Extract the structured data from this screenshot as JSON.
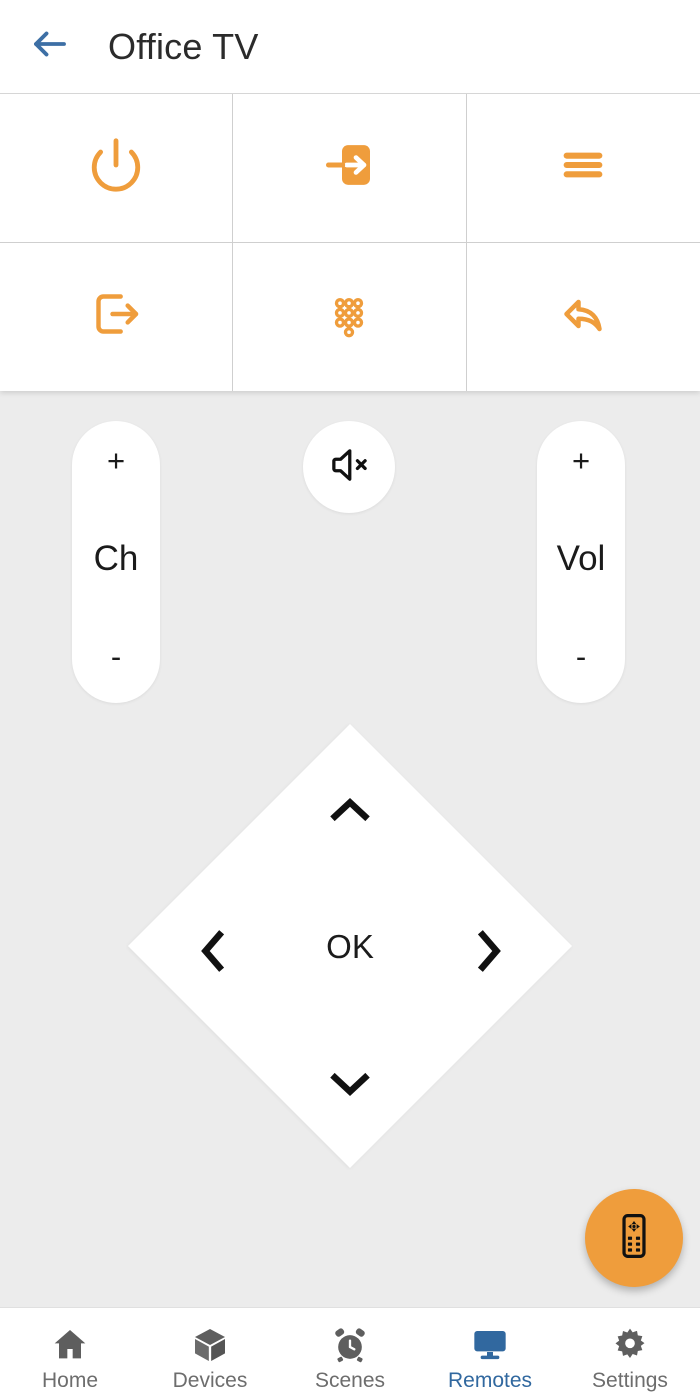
{
  "header": {
    "back_icon": "arrow-left-icon",
    "title": "Office TV",
    "back_color": "#3d6fa5"
  },
  "theme": {
    "accent_orange": "#ef9d3c",
    "active_blue": "#31689f",
    "pad_background": "#ececec",
    "surface": "#ffffff",
    "divider": "#cfcfcf",
    "text_dark": "#1b1b1b",
    "text_muted": "#6d6d6d"
  },
  "button_grid": [
    {
      "name": "power-button",
      "icon": "power-icon",
      "label": "Power"
    },
    {
      "name": "input-button",
      "icon": "input-icon",
      "label": "Input"
    },
    {
      "name": "menu-button",
      "icon": "menu-icon",
      "label": "Menu"
    },
    {
      "name": "exit-button",
      "icon": "exit-icon",
      "label": "Exit"
    },
    {
      "name": "keypad-button",
      "icon": "keypad-icon",
      "label": "Keypad"
    },
    {
      "name": "back-button",
      "icon": "reply-back-icon",
      "label": "Back"
    }
  ],
  "controls": {
    "channel": {
      "plus": "+",
      "label": "Ch",
      "minus": "-"
    },
    "volume": {
      "plus": "+",
      "label": "Vol",
      "minus": "-"
    },
    "mute": {
      "icon": "volume-mute-icon",
      "label": "Mute"
    },
    "dpad": {
      "up_icon": "chevron-up-icon",
      "down_icon": "chevron-down-icon",
      "left_icon": "chevron-left-icon",
      "right_icon": "chevron-right-icon",
      "ok_label": "OK"
    },
    "fab": {
      "icon": "remote-control-icon",
      "label": "Remote"
    }
  },
  "bottom_nav": {
    "active_index": 3,
    "items": [
      {
        "label": "Home",
        "icon": "home-icon"
      },
      {
        "label": "Devices",
        "icon": "cube-icon"
      },
      {
        "label": "Scenes",
        "icon": "alarm-clock-icon"
      },
      {
        "label": "Remotes",
        "icon": "monitor-icon"
      },
      {
        "label": "Settings",
        "icon": "gear-icon"
      }
    ]
  }
}
